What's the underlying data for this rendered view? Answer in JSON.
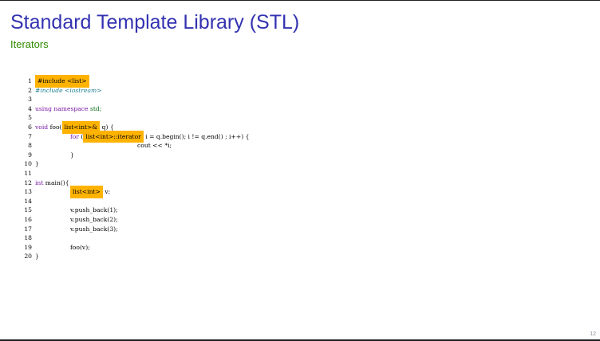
{
  "slide": {
    "title": "Standard Template Library (STL)",
    "subtitle": "Iterators",
    "page_number": "12"
  },
  "code": {
    "line_numbers": [
      "1",
      "2",
      "3",
      "4",
      "5",
      "6",
      "7",
      "8",
      "9",
      "10",
      "11",
      "12",
      "13",
      "14",
      "15",
      "16",
      "17",
      "18",
      "19",
      "20"
    ],
    "l1_include": "#include <list>",
    "l2_hash": "#",
    "l2_include": "include",
    "l2_header": "<iostream>",
    "l4_using": "using",
    "l4_namespace": "namespace",
    "l4_std": "std;",
    "l6_void": "void",
    "l6_foo": " foo(",
    "l6_param_type": "list<int>&",
    "l6_rest": " q) {",
    "l7_for": "for",
    "l7_open": " (",
    "l7_iter_type": "list<int>::iterator",
    "l7_rest": " i = q.begin(); i != q.end() ; i++) {",
    "l8_cout": "cout << *i;",
    "l9_close": "}",
    "l10_close": "}",
    "l12_int": "int",
    "l12_main": " main(){",
    "l13_type": "list<int>",
    "l13_rest": " v;",
    "l15": "v.push_back(1);",
    "l16": "v.push_back(2);",
    "l17": "v.push_back(3);",
    "l19": "foo(v);",
    "l20_close": "}"
  },
  "colors": {
    "title": "#3333b2",
    "subtitle": "#2e8b00",
    "highlight": "#ffb300",
    "keyword": "#7a1aa6",
    "type": "#0a6b18",
    "preprocessor": "#1a7f8c"
  }
}
